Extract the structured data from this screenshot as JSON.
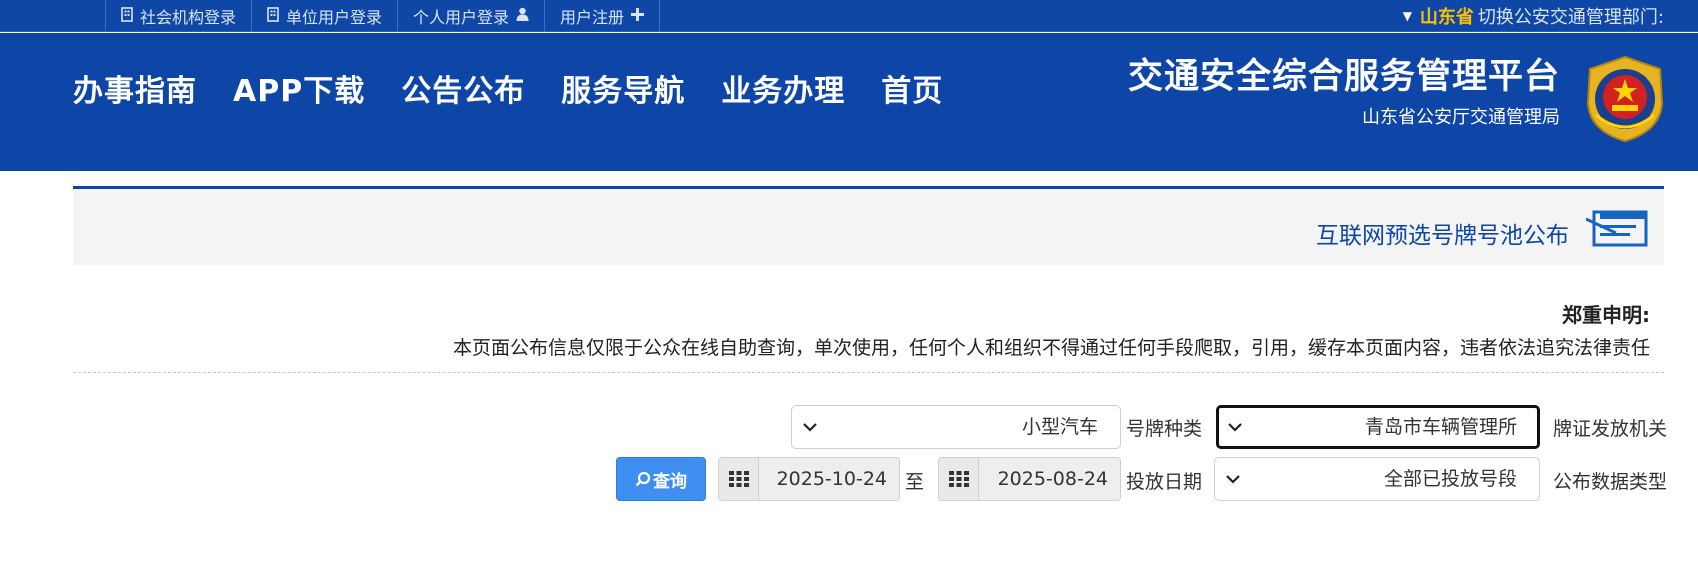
{
  "topbar": {
    "switch_label": "切换公安交通管理部门:",
    "province": "山东省",
    "links": [
      {
        "label": "用户注册",
        "icon": "plus-icon"
      },
      {
        "label": "个人用户登录",
        "icon": "user-icon"
      },
      {
        "label": "单位用户登录",
        "icon": "building-icon"
      },
      {
        "label": "社会机构登录",
        "icon": "building-icon"
      }
    ]
  },
  "brand": {
    "title": "交通安全综合服务管理平台",
    "subtitle": "山东省公安厅交通管理局",
    "emblem_icon": "police-emblem-icon"
  },
  "nav": [
    "首页",
    "业务办理",
    "服务导航",
    "公告公布",
    "APP下载",
    "办事指南"
  ],
  "panel": {
    "title": "互联网预选号牌号池公布",
    "icon": "notice-list-icon"
  },
  "disclaimer": {
    "title": "郑重申明:",
    "text": "本页面公布信息仅限于公众在线自助查询，单次使用，任何个人和组织不得通过任何手段爬取，引用，缓存本页面内容，违者依法追究法律责任"
  },
  "form": {
    "issuer_label": "牌证发放机关",
    "issuer_value": "青岛市车辆管理所",
    "plate_type_label": "号牌种类",
    "plate_type_value": "小型汽车",
    "data_type_label": "公布数据类型",
    "data_type_value": "全部已投放号段",
    "date_label": "投放日期",
    "date_from": "2025-08-24",
    "date_sep": "至",
    "date_to": "2025-10-24",
    "query_button": "查询"
  },
  "colors": {
    "header_blue": "#0d46a6",
    "province_gold": "#ffc000",
    "button_blue": "#3f8ff0"
  }
}
